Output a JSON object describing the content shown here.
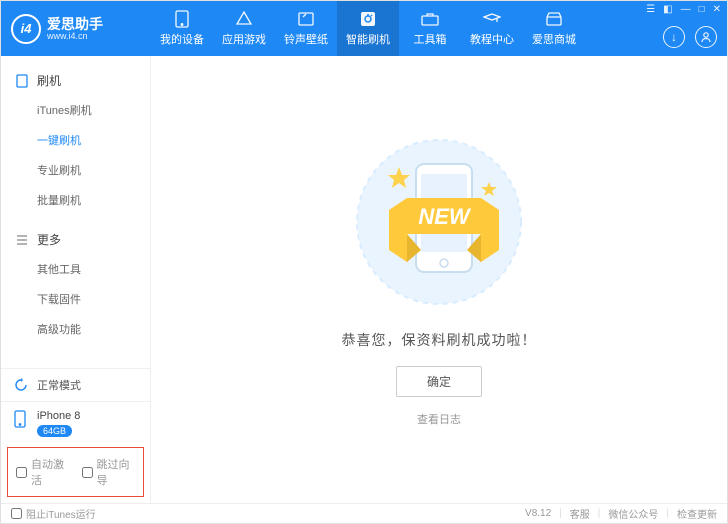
{
  "logo": {
    "badge": "i4",
    "cn": "爱思助手",
    "en": "www.i4.cn"
  },
  "top_tabs": [
    {
      "label": "我的设备"
    },
    {
      "label": "应用游戏"
    },
    {
      "label": "铃声壁纸"
    },
    {
      "label": "智能刷机"
    },
    {
      "label": "工具箱"
    },
    {
      "label": "教程中心"
    },
    {
      "label": "爱思商城"
    }
  ],
  "sidebar": {
    "sections": [
      {
        "title": "刷机",
        "items": [
          "iTunes刷机",
          "一键刷机",
          "专业刷机",
          "批量刷机"
        ]
      },
      {
        "title": "更多",
        "items": [
          "其他工具",
          "下载固件",
          "高级功能"
        ]
      }
    ],
    "status_label": "正常模式",
    "device_name": "iPhone 8",
    "device_storage": "64GB",
    "bottom_options": {
      "auto_activate": "自动激活",
      "skip_guide": "跳过向导"
    }
  },
  "content": {
    "banner_text": "NEW",
    "message": "恭喜您，保资料刷机成功啦！",
    "ok_label": "确定",
    "log_label": "查看日志"
  },
  "footer": {
    "block_itunes": "阻止iTunes运行",
    "version": "V8.12",
    "links": [
      "客服",
      "微信公众号",
      "检查更新"
    ]
  }
}
